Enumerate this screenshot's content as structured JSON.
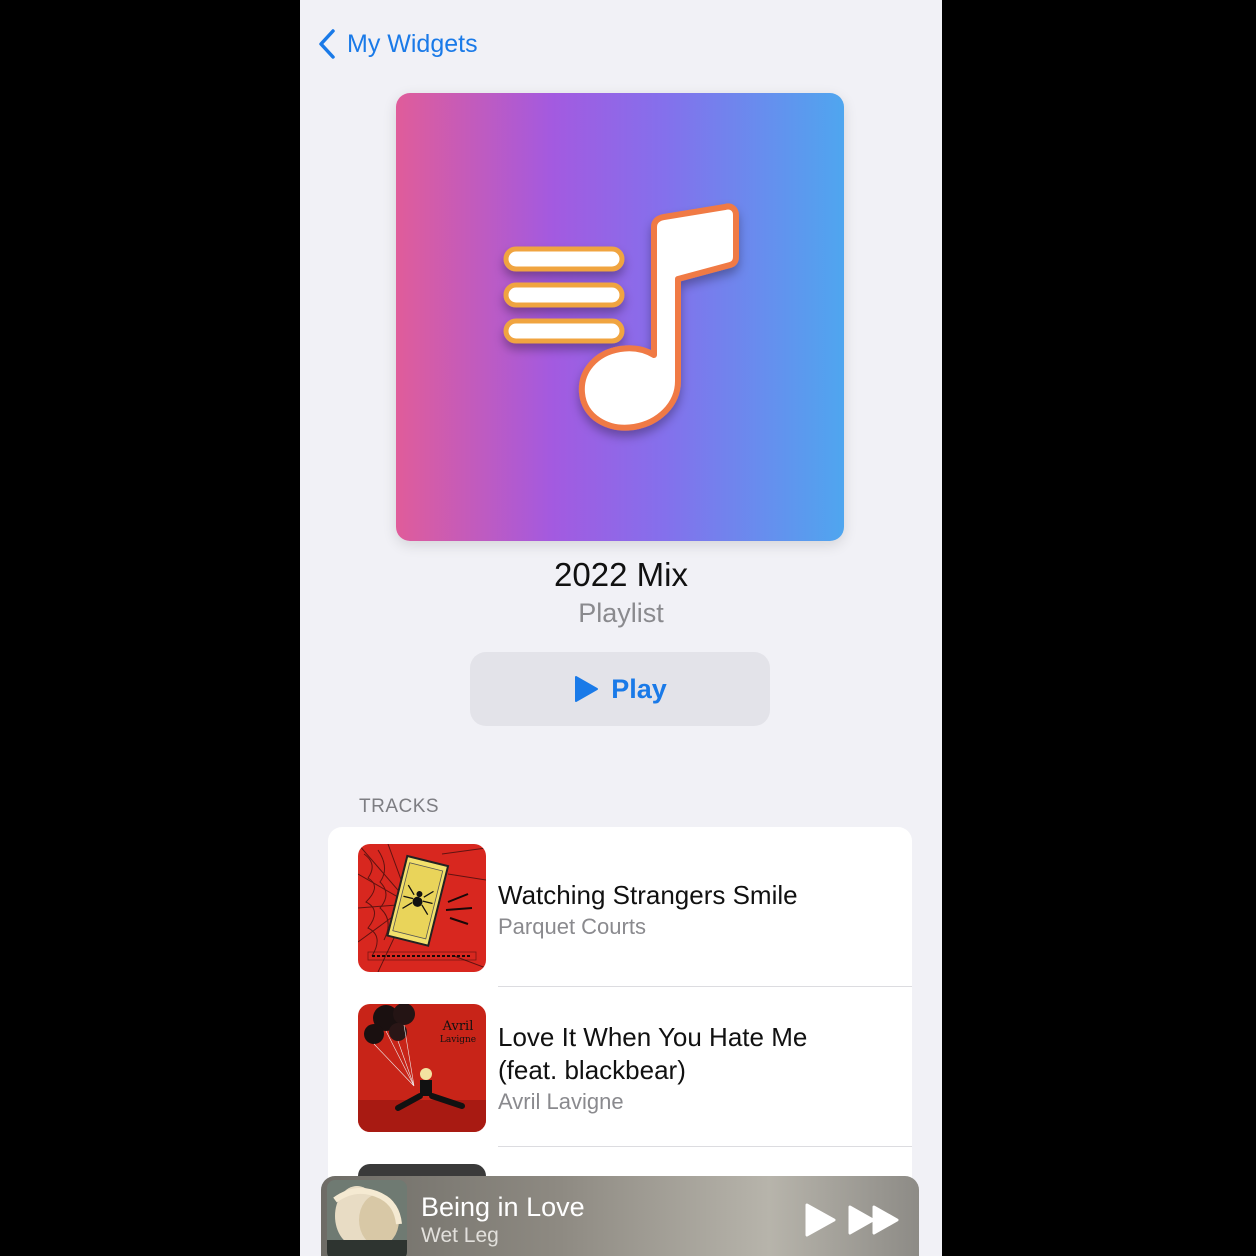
{
  "nav": {
    "back_label": "My Widgets",
    "back_icon": "chevron-left-icon"
  },
  "playlist": {
    "title": "2022 Mix",
    "type": "Playlist",
    "artwork_icon": "playlist-music-note-icon",
    "play_label": "Play"
  },
  "tracks_section": {
    "label": "TRACKS",
    "items": [
      {
        "title": "Watching Strangers Smile",
        "artist": "Parquet Courts"
      },
      {
        "title": "Love It When You Hate Me",
        "title_line2": "(feat. blackbear)",
        "artist": "Avril Lavigne"
      }
    ]
  },
  "now_playing": {
    "title": "Being in Love",
    "artist": "Wet Leg"
  },
  "colors": {
    "accent": "#1a7ae8",
    "background": "#f1f1f6"
  }
}
